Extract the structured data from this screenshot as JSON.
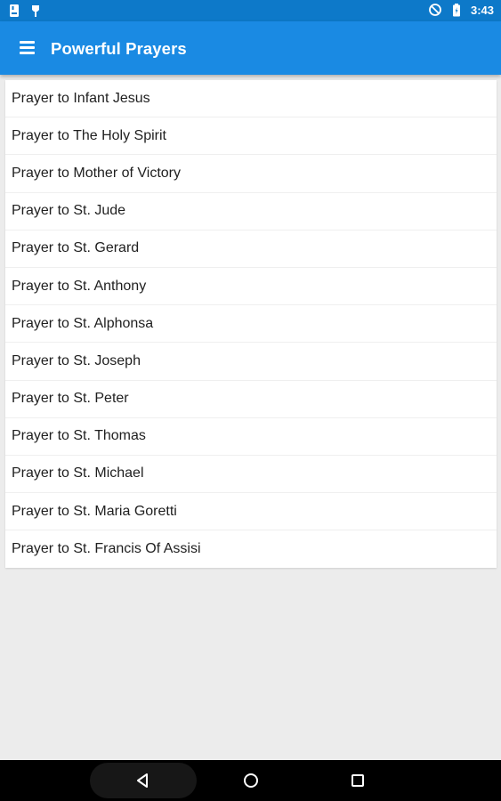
{
  "status_bar": {
    "time": "3:43",
    "left_icons": [
      "sd-card-icon",
      "notification-pin-icon"
    ],
    "right_icons": [
      "do-not-disturb-icon",
      "battery-charging-icon"
    ]
  },
  "app_bar": {
    "title": "Powerful Prayers",
    "menu_icon": "hamburger-menu-icon",
    "background_color": "#1a8ae3",
    "status_color": "#0d79c9"
  },
  "prayers": [
    "Prayer to Infant Jesus",
    "Prayer to The Holy Spirit",
    "Prayer to Mother of Victory",
    "Prayer to St. Jude",
    "Prayer to St. Gerard",
    "Prayer to St. Anthony",
    "Prayer to St. Alphonsa",
    "Prayer to St. Joseph",
    "Prayer to St. Peter",
    "Prayer to St. Thomas",
    "Prayer to St. Michael",
    "Prayer to St. Maria Goretti",
    "Prayer to St. Francis Of Assisi"
  ],
  "nav_bar": {
    "buttons": [
      "back-icon",
      "home-icon",
      "recents-icon"
    ]
  }
}
